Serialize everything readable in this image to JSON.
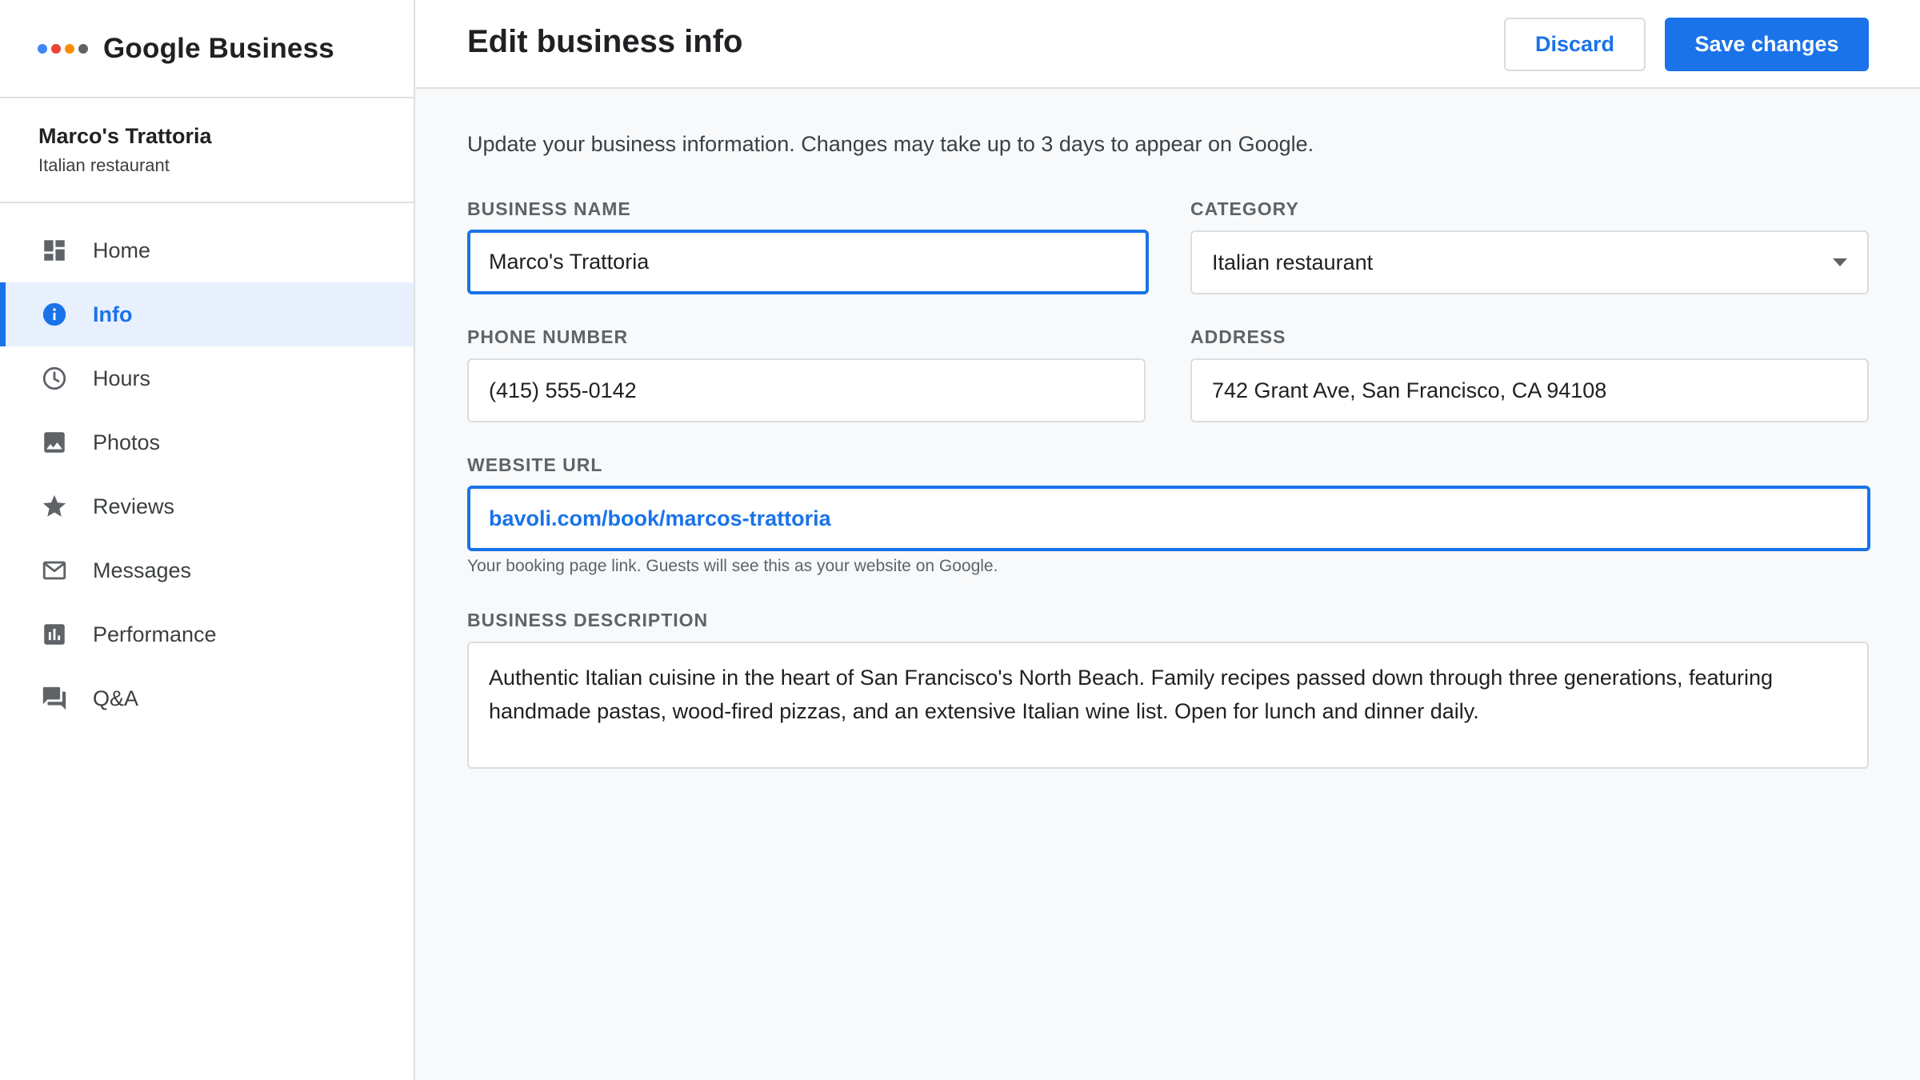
{
  "brand": {
    "name": "Google Business",
    "dot_colors": [
      "#4285f4",
      "#ea4335",
      "#fb8c00",
      "#5f6368"
    ]
  },
  "profile": {
    "name": "Marco's Trattoria",
    "category": "Italian restaurant"
  },
  "sidebar": {
    "items": [
      {
        "label": "Home",
        "icon": "dashboard-icon",
        "active": false
      },
      {
        "label": "Info",
        "icon": "info-icon",
        "active": true
      },
      {
        "label": "Hours",
        "icon": "clock-icon",
        "active": false
      },
      {
        "label": "Photos",
        "icon": "image-icon",
        "active": false
      },
      {
        "label": "Reviews",
        "icon": "star-icon",
        "active": false
      },
      {
        "label": "Messages",
        "icon": "mail-icon",
        "active": false
      },
      {
        "label": "Performance",
        "icon": "bar-chart-icon",
        "active": false
      },
      {
        "label": "Q&A",
        "icon": "forum-icon",
        "active": false
      }
    ]
  },
  "header": {
    "title": "Edit business info",
    "discard_label": "Discard",
    "save_label": "Save changes"
  },
  "form": {
    "intro": "Update your business information. Changes may take up to 3 days to appear on Google.",
    "business_name": {
      "label": "BUSINESS NAME",
      "value": "Marco's Trattoria"
    },
    "category": {
      "label": "CATEGORY",
      "value": "Italian restaurant"
    },
    "phone": {
      "label": "PHONE NUMBER",
      "value": "(415) 555-0142"
    },
    "address": {
      "label": "ADDRESS",
      "value": "742 Grant Ave, San Francisco, CA 94108"
    },
    "website": {
      "label": "WEBSITE URL",
      "value": "bavoli.com/book/marcos-trattoria",
      "helper": "Your booking page link. Guests will see this as your website on Google."
    },
    "description": {
      "label": "BUSINESS DESCRIPTION",
      "value": "Authentic Italian cuisine in the heart of San Francisco's North Beach. Family recipes passed down through three generations, featuring handmade pastas, wood-fired pizzas, and an extensive Italian wine list. Open for lunch and dinner daily."
    }
  },
  "colors": {
    "accent": "#1a73e8",
    "active_bg": "#e8f0fe",
    "icon_gray": "#5f6368"
  }
}
